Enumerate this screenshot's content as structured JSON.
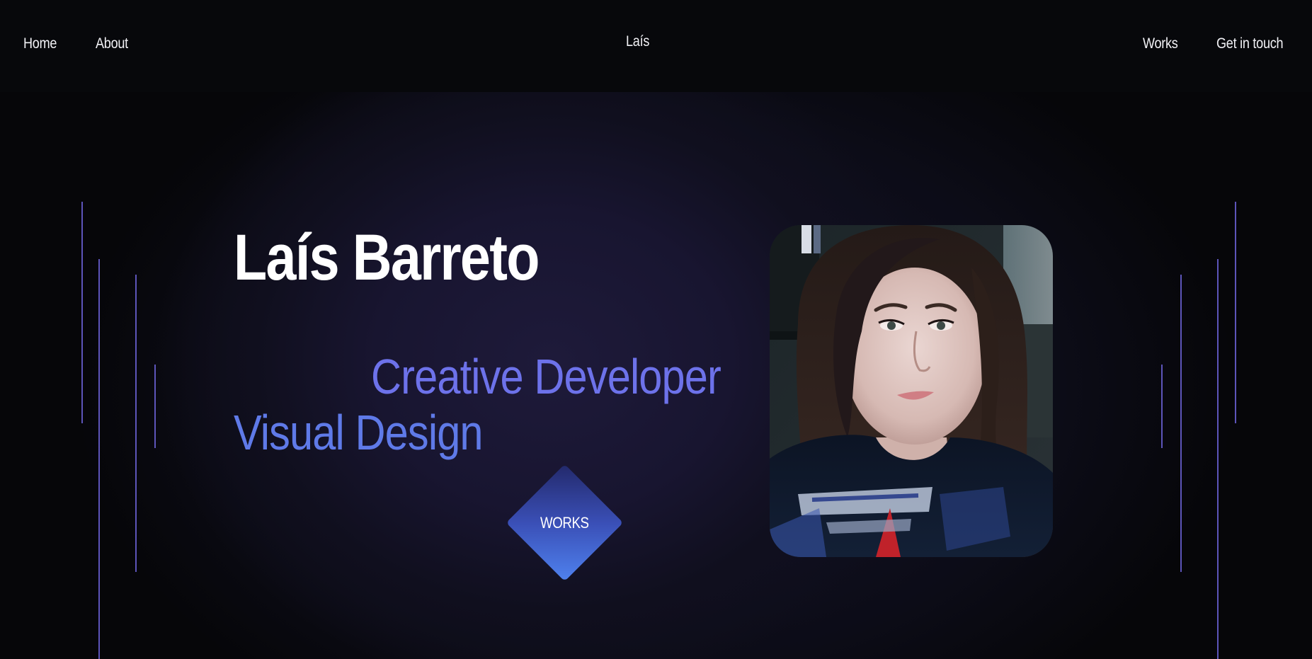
{
  "nav": {
    "home": "Home",
    "about": "About",
    "brand": "Laís",
    "works": "Works",
    "contact": "Get in touch"
  },
  "hero": {
    "name": "Laís Barreto",
    "role_primary": "Creative Developer",
    "role_secondary": "Visual Design",
    "cta_label": "WORKS",
    "portrait_alt": "Portrait photo"
  },
  "colors": {
    "background": "#06060a",
    "hero_glow": "#1e1a3a",
    "accent_line": "#6c63d8",
    "role_primary": "#6d72ea",
    "role_secondary": "#5f7ae8",
    "cta_gradient_start": "#23296b",
    "cta_gradient_end": "#4f82ef",
    "text": "#ffffff"
  }
}
